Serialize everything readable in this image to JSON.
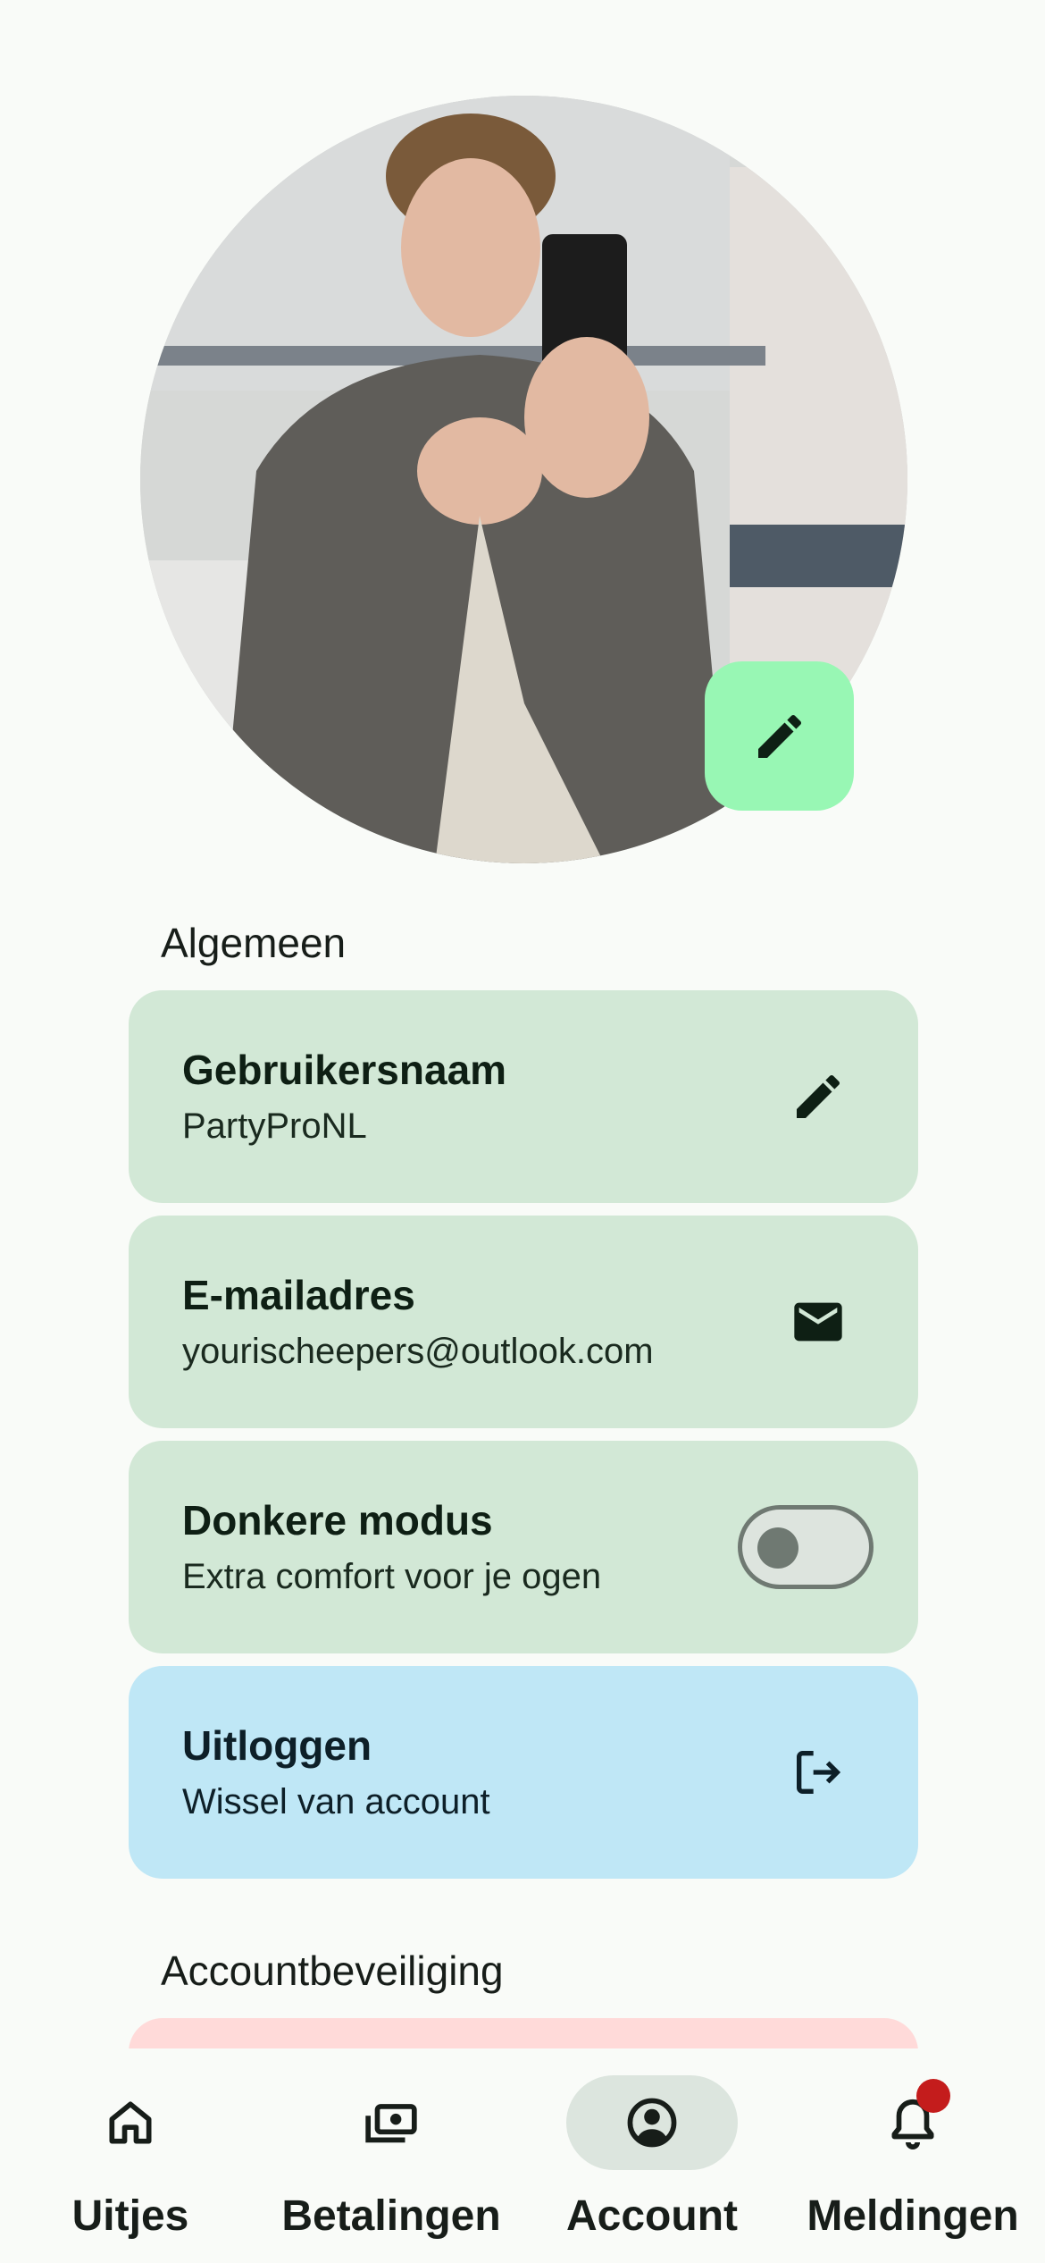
{
  "profile": {
    "avatar_alt": "Profielfoto",
    "edit_icon": "pencil-icon",
    "accent_color": "#98f7b4"
  },
  "sections": {
    "general_title": "Algemeen",
    "security_title": "Accountbeveiliging"
  },
  "cards": {
    "username": {
      "title": "Gebruikersnaam",
      "value": "PartyProNL",
      "icon": "pencil-icon"
    },
    "email": {
      "title": "E-mailadres",
      "value": "yourischeepers@outlook.com",
      "icon": "mail-icon"
    },
    "dark_mode": {
      "title": "Donkere modus",
      "value": "Extra comfort voor je ogen",
      "toggle_on": false
    },
    "logout": {
      "title": "Uitloggen",
      "value": "Wissel van account",
      "icon": "logout-icon"
    }
  },
  "colors": {
    "card_green": "#d2e8d6",
    "card_blue": "#bfe7f6",
    "card_red_peek": "#ffdad9",
    "badge_red": "#c41c1c"
  },
  "nav": {
    "items": [
      {
        "label": "Uitjes",
        "icon": "home-icon",
        "active": false
      },
      {
        "label": "Betalingen",
        "icon": "payments-icon",
        "active": false
      },
      {
        "label": "Account",
        "icon": "account-circle-icon",
        "active": true
      },
      {
        "label": "Meldingen",
        "icon": "bell-icon",
        "active": false,
        "has_badge": true
      }
    ]
  }
}
